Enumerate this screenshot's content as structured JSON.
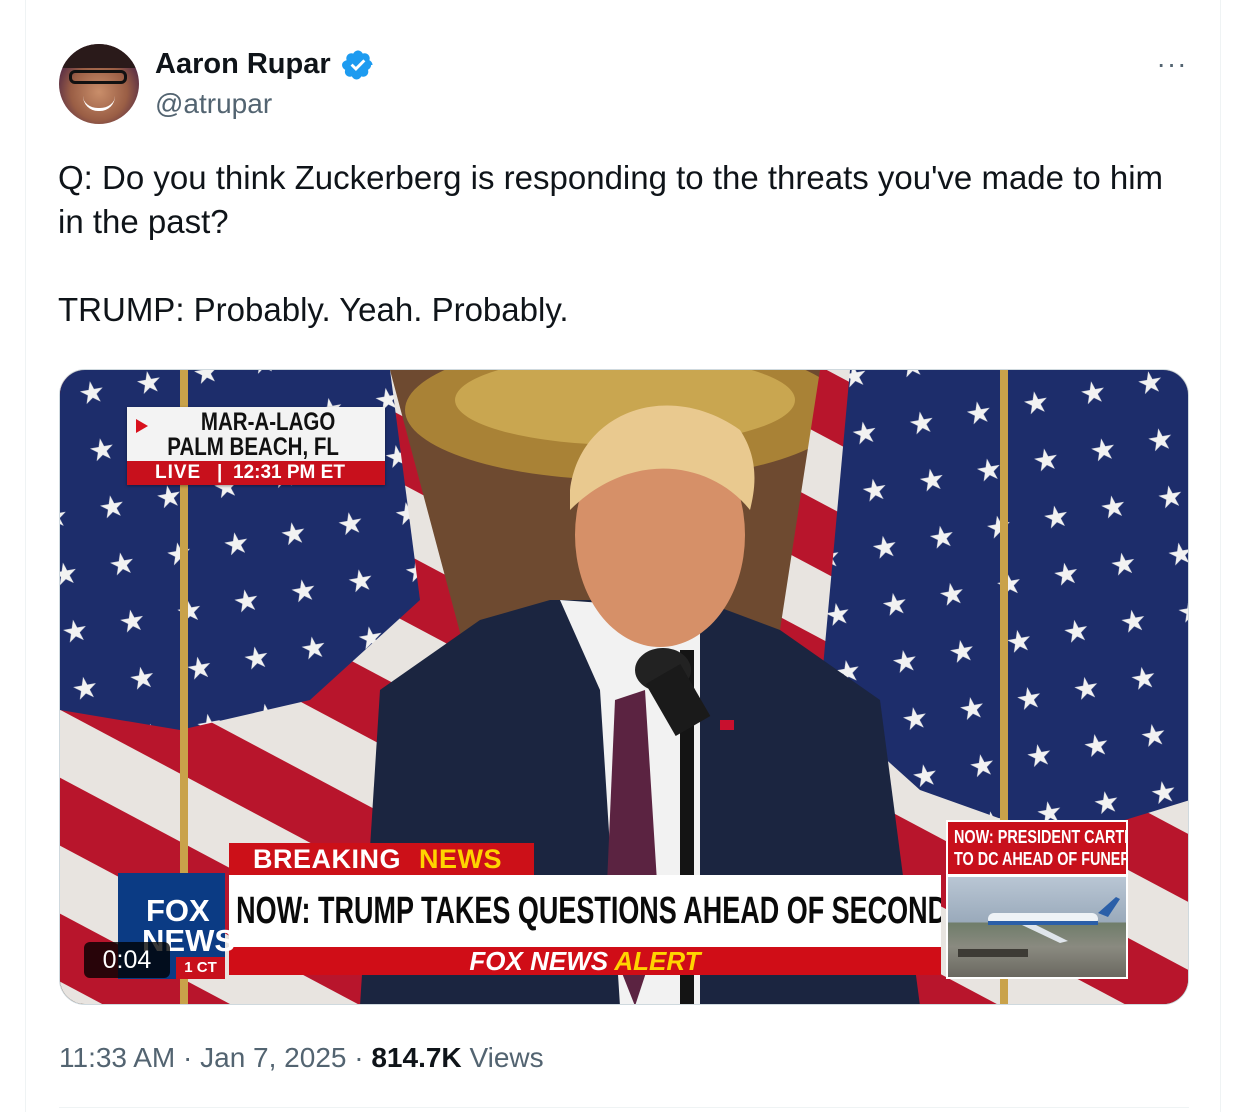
{
  "author": {
    "name": "Aaron Rupar",
    "handle": "@atrupar",
    "verified": true,
    "avatar_icon": "profile-photo"
  },
  "more_menu": {
    "label": "···"
  },
  "tweet": {
    "line1": "Q: Do you think Zuckerberg is responding to the threats you've made to him in the past?",
    "line2": "TRUMP: Probably. Yeah. Probably."
  },
  "video": {
    "timer": "0:04",
    "overlay": {
      "location_line1": "MAR-A-LAGO",
      "location_line2": "PALM BEACH, FL",
      "live_label": "LIVE",
      "separator": "|",
      "time": "12:31 PM ET",
      "breaking_word1": "BREAKING",
      "breaking_word2": "NEWS",
      "headline": "NOW: TRUMP TAKES QUESTIONS AHEAD OF SECOND TERM",
      "alert_word1": "FOX NEWS",
      "alert_word2": "ALERT",
      "logo_line1": "FOX",
      "logo_line2": "NEWS",
      "logo_time": "1 CT",
      "side_line1": "NOW: PRESIDENT CARTER",
      "side_line2": "TO DC AHEAD OF FUNERAL"
    }
  },
  "meta": {
    "time": "11:33 AM",
    "dot": "·",
    "date": "Jan 7, 2025",
    "views_count": "814.7K",
    "views_label": "Views"
  },
  "colors": {
    "text_primary": "#0f1419",
    "text_secondary": "#536471",
    "verified_blue": "#1d9bf0",
    "fox_red": "#c8101c",
    "fox_blue": "#0b3b84",
    "fox_yellow": "#ffd400"
  }
}
